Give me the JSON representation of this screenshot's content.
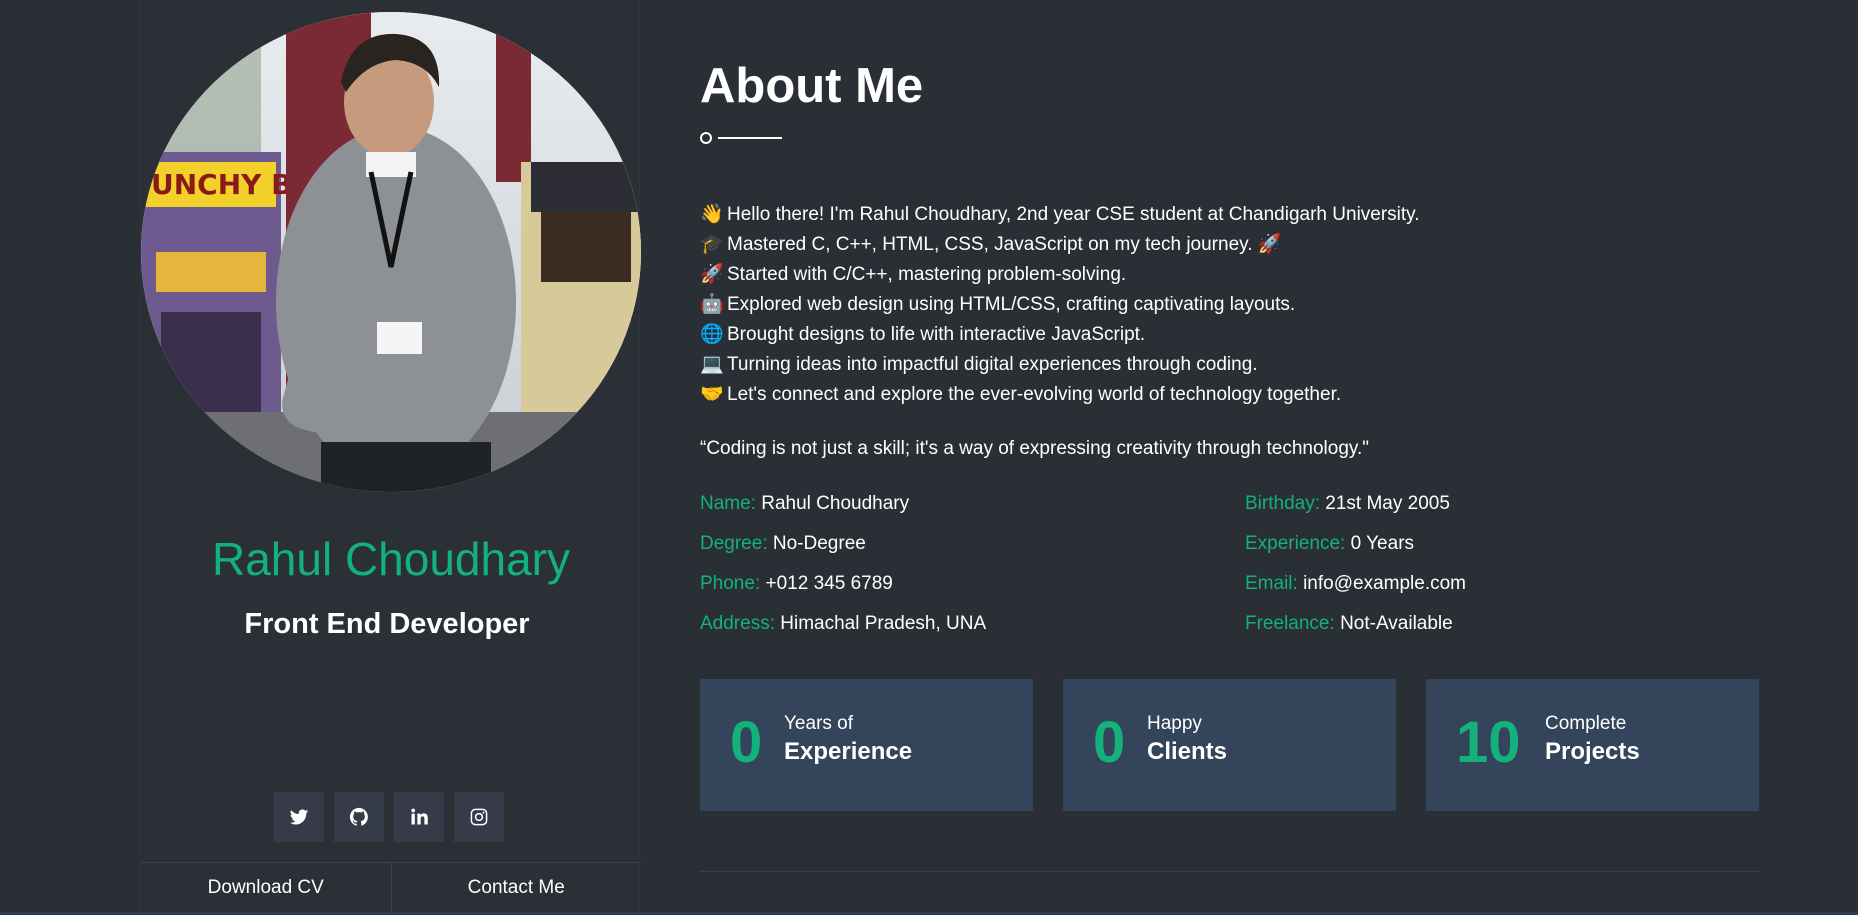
{
  "profile": {
    "name": "Rahul Choudhary",
    "role": "Front End Developer",
    "photo_alt": "portrait photo"
  },
  "socials": [
    {
      "name": "twitter",
      "icon": "twitter-icon"
    },
    {
      "name": "github",
      "icon": "github-icon"
    },
    {
      "name": "linkedin",
      "icon": "linkedin-icon"
    },
    {
      "name": "instagram",
      "icon": "instagram-icon"
    }
  ],
  "actions": {
    "download": "Download CV",
    "contact": "Contact Me"
  },
  "about": {
    "title": "About Me",
    "bio": [
      {
        "emoji": "👋",
        "text": "Hello there! I'm Rahul Choudhary, 2nd year CSE student at Chandigarh University."
      },
      {
        "emoji": "🎓",
        "text": "Mastered C, C++, HTML, CSS, JavaScript on my tech journey. 🚀"
      },
      {
        "emoji": "🚀",
        "text": "Started with C/C++, mastering problem-solving."
      },
      {
        "emoji": "🤖",
        "text": "Explored web design using HTML/CSS, crafting captivating layouts."
      },
      {
        "emoji": "🌐",
        "text": "Brought designs to life with interactive JavaScript."
      },
      {
        "emoji": "💻",
        "text": "Turning ideas into impactful digital experiences through coding."
      },
      {
        "emoji": "🤝",
        "text": "Let's connect and explore the ever-evolving world of technology together."
      }
    ],
    "quote": "“Coding is not just a skill; it's a way of expressing creativity through technology.\""
  },
  "info": {
    "name": {
      "label": "Name:",
      "value": "Rahul Choudhary"
    },
    "degree": {
      "label": "Degree:",
      "value": "No-Degree"
    },
    "phone": {
      "label": "Phone:",
      "value": "+012 345 6789"
    },
    "address": {
      "label": "Address:",
      "value": "Himachal Pradesh, UNA"
    },
    "birthday": {
      "label": "Birthday:",
      "value": "21st May 2005"
    },
    "experience": {
      "label": "Experience:",
      "value": "0 Years"
    },
    "email": {
      "label": "Email:",
      "value": "info@example.com"
    },
    "freelance": {
      "label": "Freelance:",
      "value": "Not-Available"
    }
  },
  "stats": [
    {
      "number": "0",
      "top": "Years of",
      "bottom": "Experience"
    },
    {
      "number": "0",
      "top": "Happy",
      "bottom": "Clients"
    },
    {
      "number": "10",
      "top": "Complete",
      "bottom": "Projects"
    }
  ],
  "colors": {
    "background": "#2a2e35",
    "accent": "#12b27a",
    "panel": "#34445a",
    "social_bg": "#353b48"
  }
}
